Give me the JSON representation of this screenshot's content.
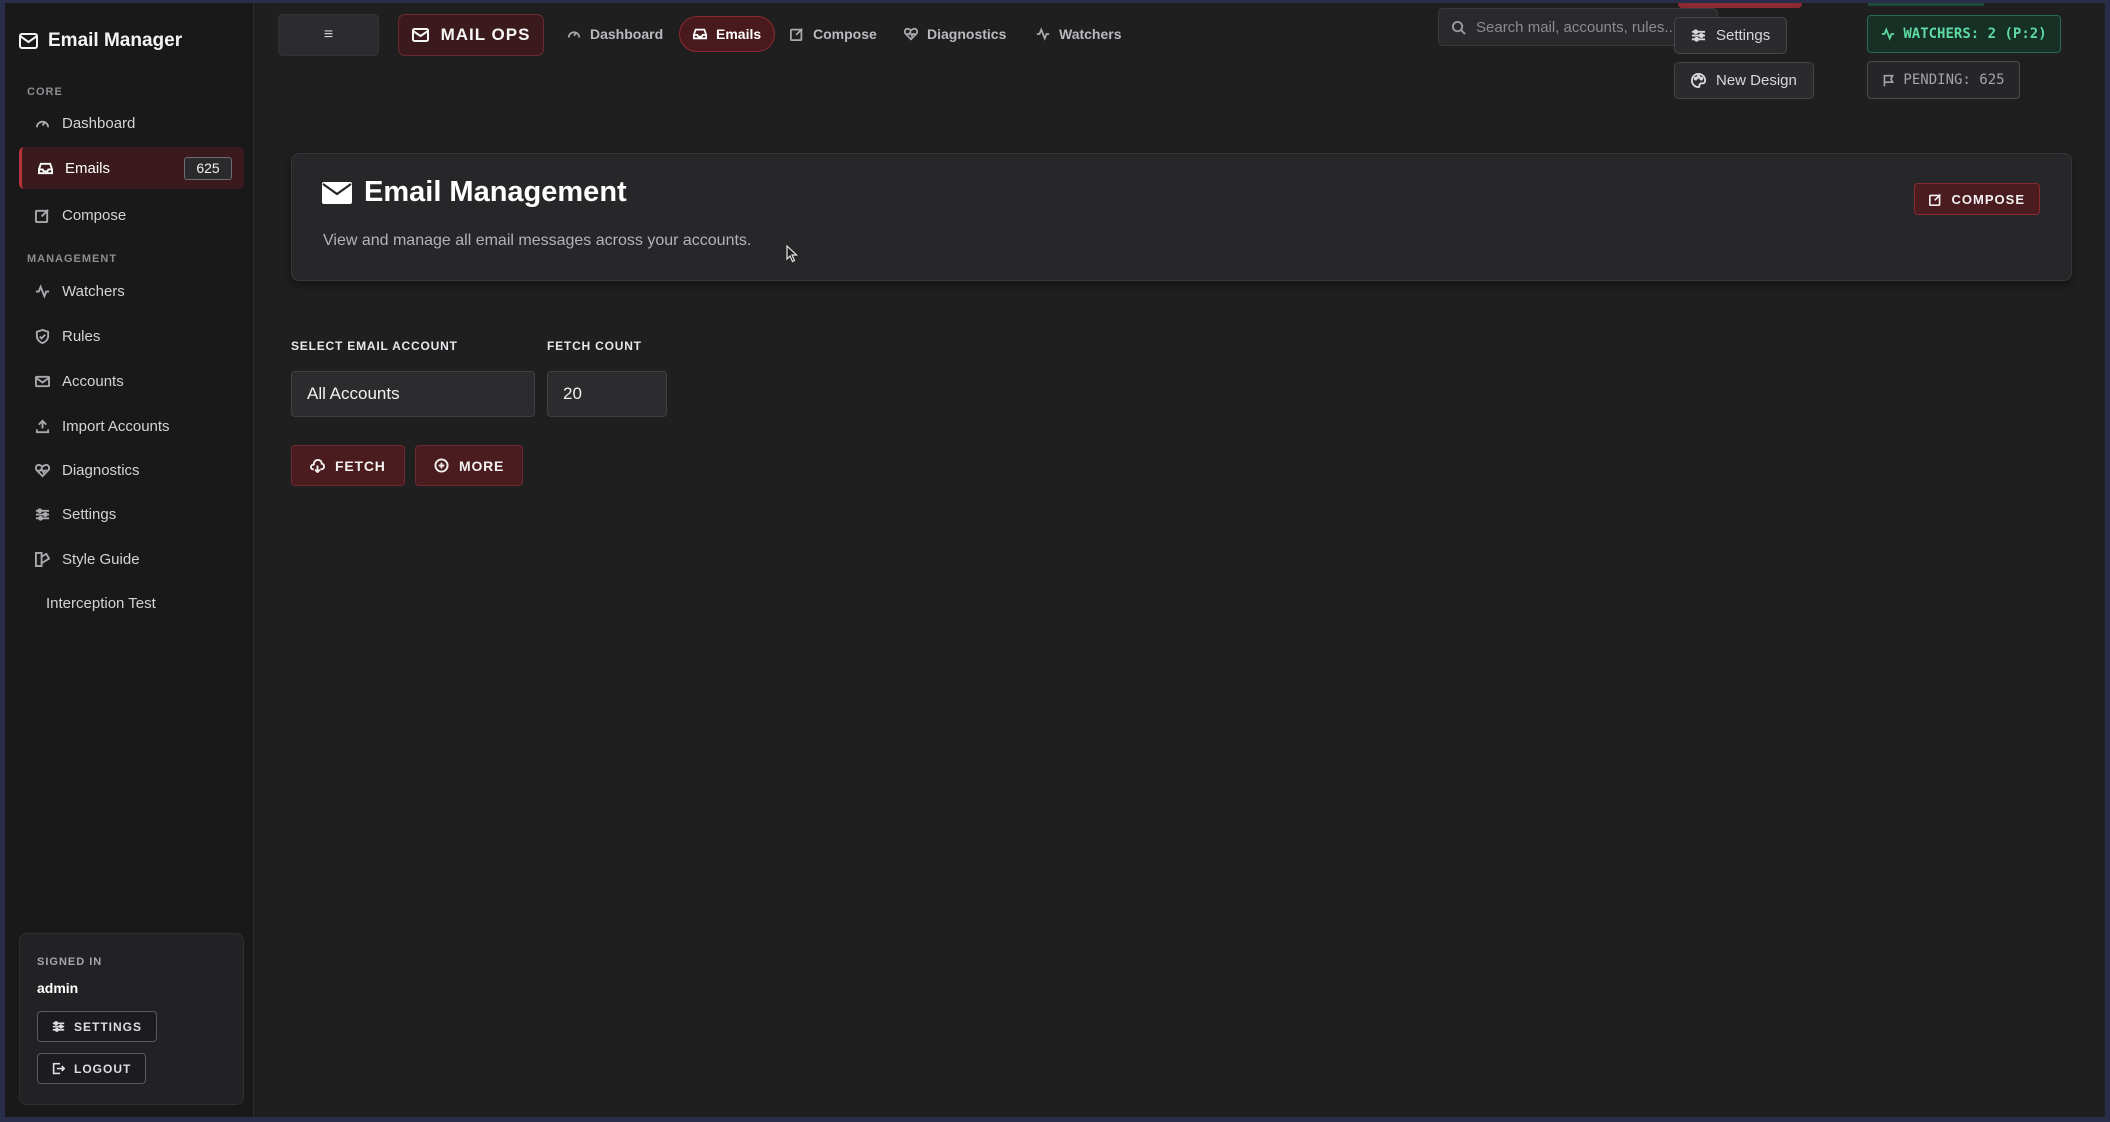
{
  "sidebar": {
    "brand": "Email Manager",
    "sections": {
      "core": "CORE",
      "management": "MANAGEMENT"
    },
    "items": [
      {
        "label": "Dashboard",
        "icon": "gauge-icon"
      },
      {
        "label": "Emails",
        "icon": "inbox-icon",
        "badge": "625",
        "active": true
      },
      {
        "label": "Compose",
        "icon": "edit-icon"
      },
      {
        "label": "Watchers",
        "icon": "activity-icon"
      },
      {
        "label": "Rules",
        "icon": "shield-icon"
      },
      {
        "label": "Accounts",
        "icon": "mail-icon"
      },
      {
        "label": "Import Accounts",
        "icon": "upload-icon"
      },
      {
        "label": "Diagnostics",
        "icon": "heart-pulse-icon"
      },
      {
        "label": "Settings",
        "icon": "sliders-icon"
      },
      {
        "label": "Style Guide",
        "icon": "palette-icon"
      },
      {
        "label": "Interception Test",
        "icon": ""
      }
    ],
    "signed_in": {
      "label": "SIGNED IN",
      "user": "admin",
      "settings_label": "SETTINGS",
      "logout_label": "LOGOUT"
    }
  },
  "topbar": {
    "menu_glyph": "≡",
    "brand": "MAIL OPS",
    "tabs": [
      {
        "label": "Dashboard",
        "icon": "gauge-icon"
      },
      {
        "label": "Emails",
        "icon": "inbox-icon",
        "active": true
      },
      {
        "label": "Compose",
        "icon": "edit-icon"
      },
      {
        "label": "Diagnostics",
        "icon": "heart-pulse-icon"
      },
      {
        "label": "Watchers",
        "icon": "activity-icon"
      }
    ],
    "search_placeholder": "Search mail, accounts, rules...",
    "settings_label": "Settings",
    "new_design_label": "New Design",
    "watchers_status": "WATCHERS: 2 (P:2)",
    "pending_status": "PENDING: 625"
  },
  "main": {
    "title": "Email Management",
    "subtitle": "View and manage all email messages across your accounts.",
    "compose_label": "COMPOSE",
    "form": {
      "account_label": "SELECT EMAIL ACCOUNT",
      "account_value": "All Accounts",
      "count_label": "FETCH COUNT",
      "count_value": "20",
      "fetch_label": "FETCH",
      "more_label": "MORE"
    }
  },
  "colors": {
    "accent": "#b4323a",
    "accent_bg": "#4a1b1f",
    "success": "#5fd8a2",
    "background": "#1f1f20"
  }
}
